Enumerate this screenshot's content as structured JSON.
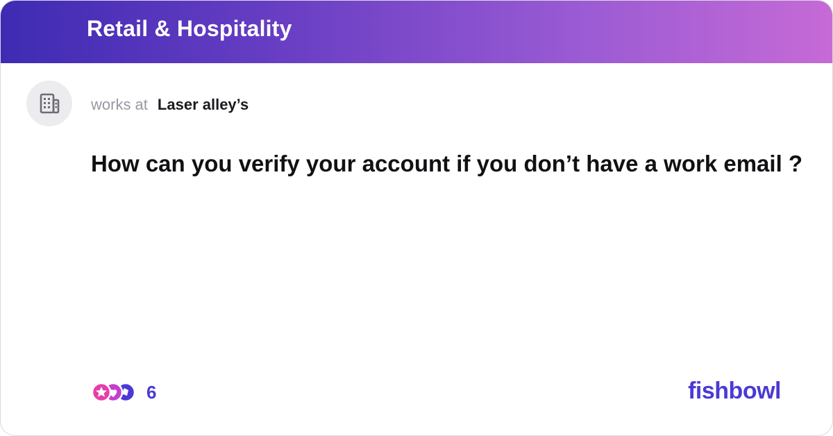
{
  "header": {
    "title": "Retail & Hospitality"
  },
  "author": {
    "label": "works at",
    "company": "Laser alley’s",
    "avatar_icon": "building-icon"
  },
  "post": {
    "question": "How can you verify your account if you don’t have a work email ?"
  },
  "reactions": {
    "count": "6",
    "icons": [
      "star-reaction-icon",
      "heart-reaction-icon",
      "thumb-reaction-icon"
    ]
  },
  "brand": {
    "name": "fishbowl"
  },
  "colors": {
    "accent": "#4b39d6",
    "header_start": "#3e2bb3",
    "header_end": "#c66ad6"
  }
}
